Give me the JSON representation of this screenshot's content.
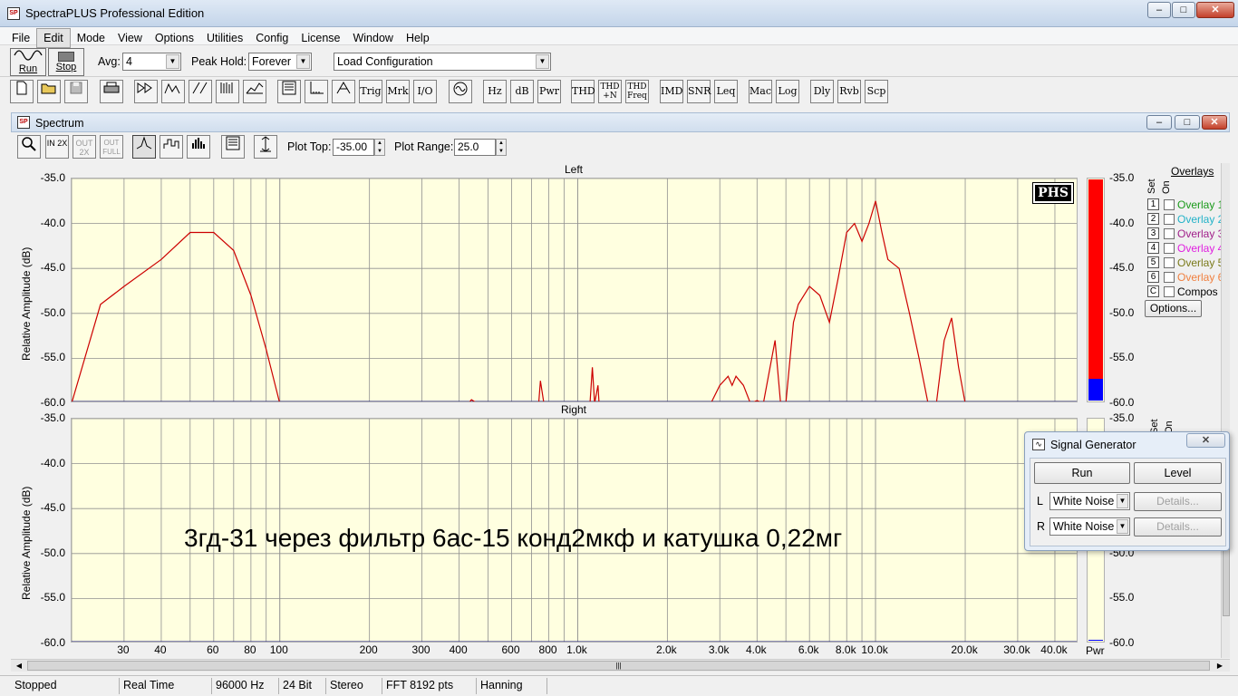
{
  "window": {
    "title": "SpectraPLUS Professional Edition"
  },
  "menu": [
    "File",
    "Edit",
    "Mode",
    "View",
    "Options",
    "Utilities",
    "Config",
    "License",
    "Window",
    "Help"
  ],
  "toolbar": {
    "run_label": "Run",
    "stop_label": "Stop",
    "avg_label": "Avg:",
    "avg_value": "4",
    "peak_hold_label": "Peak Hold:",
    "peak_hold_value": "Forever",
    "config_value": "Load Configuration",
    "buttons_text": [
      "Trig",
      "Mrk",
      "I/O",
      "Hz",
      "dB",
      "Pwr",
      "THD",
      "THD +N",
      "THD Freq",
      "IMD",
      "SNR",
      "Leq",
      "Mac",
      "Log",
      "Dly",
      "Rvb",
      "Scp"
    ]
  },
  "spectrum": {
    "title": "Spectrum",
    "toolbar_small": [
      "IN 2X",
      "OUT 2X",
      "OUT FULL"
    ],
    "plot_top_label": "Plot Top:",
    "plot_top_value": "-35.00",
    "plot_range_label": "Plot Range:",
    "plot_range_value": "25.0",
    "phs_badge": "PHS",
    "annotation": "3гд-31 через фильтр 6ас-15 конд2мкф и катушка 0,22мг",
    "power_label": "Pwr",
    "overlays": {
      "title": "Overlays",
      "set_label": "Set",
      "on_label": "On",
      "items": [
        {
          "num": "1",
          "label": "Overlay 1",
          "color": "#1a9a1a"
        },
        {
          "num": "2",
          "label": "Overlay 2",
          "color": "#22b2c8"
        },
        {
          "num": "3",
          "label": "Overlay 3",
          "color": "#a0208a"
        },
        {
          "num": "4",
          "label": "Overlay 4",
          "color": "#e020e0"
        },
        {
          "num": "5",
          "label": "Overlay 5",
          "color": "#7a7a1a"
        },
        {
          "num": "6",
          "label": "Overlay 6",
          "color": "#f08040"
        },
        {
          "num": "C",
          "label": "Compos",
          "color": "#000000"
        }
      ],
      "options_label": "Options..."
    }
  },
  "chart_data": [
    {
      "type": "line",
      "title": "Left",
      "ylabel": "Relative Amplitude (dB)",
      "xscale": "log",
      "xlim": [
        20,
        48000
      ],
      "ylim": [
        -60,
        -35
      ],
      "y_ticks": [
        "-35.0",
        "-40.0",
        "-45.0",
        "-50.0",
        "-55.0",
        "-60.0"
      ],
      "grid": true,
      "series": [
        {
          "color": "#cc0000",
          "x": [
            20,
            25,
            30,
            40,
            50,
            60,
            70,
            80,
            90,
            100,
            430,
            440,
            460,
            740,
            750,
            770,
            1100,
            1120,
            1140,
            1170,
            1180,
            2800,
            3000,
            3200,
            3300,
            3400,
            3600,
            3800,
            4000,
            4200,
            4600,
            4800,
            5000,
            5300,
            5500,
            6000,
            6500,
            7000,
            7500,
            8000,
            8500,
            9000,
            9500,
            10000,
            10500,
            11000,
            12000,
            13000,
            14000,
            15000,
            16000,
            17000,
            18000,
            19000,
            20000,
            21000
          ],
          "y": [
            -60,
            -49,
            -47,
            -44,
            -41,
            -41,
            -43,
            -48,
            -54,
            -60,
            -60,
            -59.6,
            -60,
            -60,
            -57.5,
            -60,
            -60,
            -56,
            -60,
            -58,
            -60,
            -60,
            -58,
            -57,
            -58,
            -57,
            -58,
            -60,
            -59.7,
            -60,
            -53,
            -60,
            -60,
            -51,
            -49,
            -47,
            -48,
            -51,
            -46,
            -41,
            -40,
            -42,
            -40,
            -37.5,
            -41,
            -44,
            -45,
            -50,
            -55,
            -60,
            -60,
            -53,
            -50.5,
            -56,
            -60,
            -60
          ]
        }
      ],
      "meter": {
        "red_level": -57.3,
        "blue_level": -60.0
      }
    },
    {
      "type": "line",
      "title": "Right",
      "ylabel": "Relative Amplitude (dB)",
      "xscale": "log",
      "xlim": [
        20,
        48000
      ],
      "ylim": [
        -60,
        -35
      ],
      "y_ticks": [
        "-35.0",
        "-40.0",
        "-45.0",
        "-50.0",
        "-55.0",
        "-60.0"
      ],
      "x_ticks": [
        "30",
        "40",
        "60",
        "80",
        "100",
        "200",
        "300",
        "400",
        "600",
        "800",
        "1.0k",
        "2.0k",
        "3.0k",
        "4.0k",
        "6.0k",
        "8.0k",
        "10.0k",
        "20.0k",
        "30.0k",
        "40.0k"
      ],
      "x_tick_values": [
        30,
        40,
        60,
        80,
        100,
        200,
        300,
        400,
        600,
        800,
        1000,
        2000,
        3000,
        4000,
        6000,
        8000,
        10000,
        20000,
        30000,
        40000
      ],
      "grid": true,
      "series": []
    }
  ],
  "signal_generator": {
    "title": "Signal Generator",
    "run_label": "Run",
    "level_label": "Level",
    "left_label": "L",
    "right_label": "R",
    "left_value": "White Noise",
    "right_value": "White Noise",
    "details_label": "Details..."
  },
  "status": [
    "Stopped",
    "Real Time",
    "96000 Hz",
    "24 Bit",
    "Stereo",
    "FFT 8192 pts",
    "Hanning"
  ]
}
